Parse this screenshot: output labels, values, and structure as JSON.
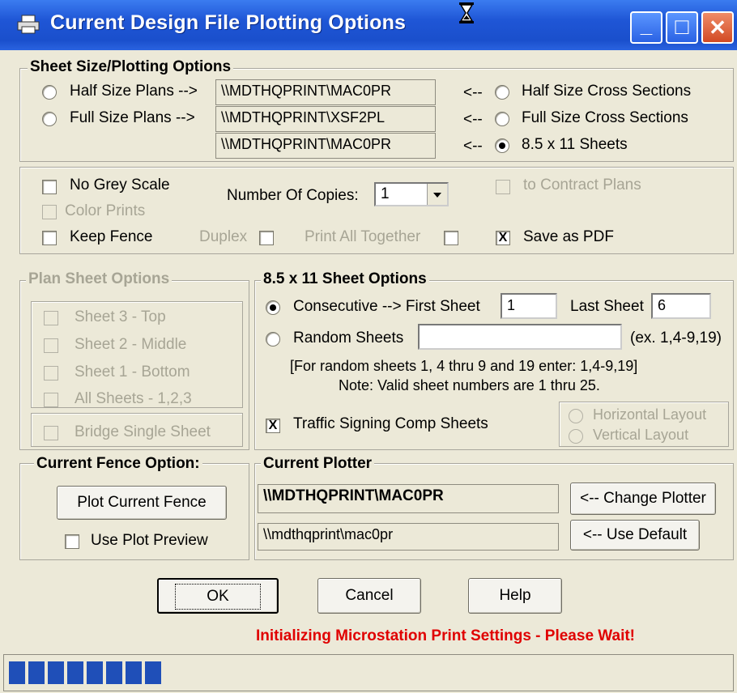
{
  "window": {
    "title": "Current Design File Plotting Options",
    "minimize_glyph": "_",
    "maximize_glyph": "□",
    "close_glyph": "✕"
  },
  "sheet_size": {
    "title": "Sheet Size/Plotting Options",
    "half_size_plans": "Half Size Plans -->",
    "full_size_plans": "Full Size Plans -->",
    "half_printer": "\\\\MDTHQPRINT\\MAC0PR",
    "full_printer": "\\\\MDTHQPRINT\\XSF2PL",
    "letter_printer": "\\\\MDTHQPRINT\\MAC0PR",
    "arrow": "<--",
    "half_size_cross": "Half Size Cross Sections",
    "full_size_cross": "Full Size Cross Sections",
    "letter_sheets": "8.5 x 11 Sheets"
  },
  "options": {
    "no_grey_scale": "No Grey Scale",
    "color_prints": "Color Prints",
    "keep_fence": "Keep Fence",
    "number_of_copies": "Number Of Copies:",
    "copies_value": "1",
    "duplex": "Duplex",
    "print_all_together": "Print All Together",
    "to_contract_plans": "to Contract Plans",
    "save_as_pdf": "Save as PDF",
    "check_mark": "X"
  },
  "plan_sheet": {
    "title": "Plan Sheet Options",
    "sheet3": "Sheet 3 - Top",
    "sheet2": "Sheet 2 - Middle",
    "sheet1": "Sheet 1 - Bottom",
    "all_sheets": "All Sheets - 1,2,3",
    "bridge": "Bridge Single Sheet"
  },
  "letter_options": {
    "title": "8.5 x 11 Sheet Options",
    "consecutive": "Consecutive --> First Sheet",
    "first_sheet": "1",
    "last_sheet_label": "Last Sheet",
    "last_sheet": "6",
    "random_sheets": "Random Sheets",
    "random_value": "",
    "example": "(ex. 1,4-9,19)",
    "random_note": "[For random sheets 1, 4 thru 9 and 19 enter:  1,4-9,19]",
    "valid_note": "Note:  Valid sheet numbers are 1 thru 25.",
    "traffic": "Traffic Signing Comp Sheets",
    "horizontal": "Horizontal Layout",
    "vertical": "Vertical Layout"
  },
  "fence": {
    "title": "Current Fence Option:",
    "plot_button": "Plot Current Fence",
    "use_preview": "Use Plot Preview"
  },
  "plotter": {
    "title": "Current Plotter",
    "current": "\\\\MDTHQPRINT\\MAC0PR",
    "default": "\\\\mdthqprint\\mac0pr",
    "change_button": "<-- Change Plotter",
    "default_button": "<-- Use Default"
  },
  "buttons": {
    "ok": "OK",
    "cancel": "Cancel",
    "help": "Help"
  },
  "status": {
    "message": "Initializing Microstation Print Settings - Please Wait!",
    "progress_blocks": 8
  }
}
